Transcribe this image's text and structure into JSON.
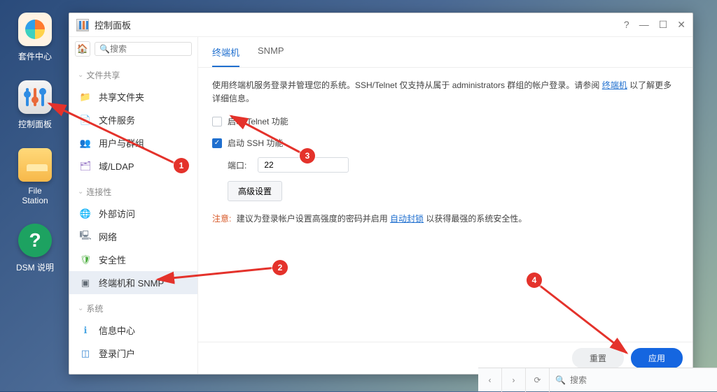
{
  "desktop": {
    "icons": [
      {
        "label": "套件中心",
        "name": "pkg-center"
      },
      {
        "label": "控制面板",
        "name": "control-panel"
      },
      {
        "label": "File Station",
        "name": "file-station"
      },
      {
        "label": "DSM 说明",
        "name": "dsm-help"
      }
    ]
  },
  "window": {
    "title": "控制面板",
    "search_placeholder": "搜索"
  },
  "sidebar": {
    "sections": {
      "fs": "文件共享",
      "conn": "连接性",
      "sys": "系统"
    },
    "items": {
      "shared_folder": "共享文件夹",
      "file_services": "文件服务",
      "user_group": "用户与群组",
      "domain_ldap": "域/LDAP",
      "ext_access": "外部访问",
      "network": "网络",
      "security": "安全性",
      "terminal_snmp": "终端机和 SNMP",
      "info_center": "信息中心",
      "login_portal": "登录门户"
    }
  },
  "tabs": {
    "terminal": "终端机",
    "snmp": "SNMP"
  },
  "content": {
    "desc_pre": "使用终端机服务登录并管理您的系统。SSH/Telnet 仅支持从属于 administrators 群组的帐户登录。请参阅",
    "desc_link": "终端机",
    "desc_post": "以了解更多详细信息。",
    "telnet_cb": "启动 Telnet 功能",
    "ssh_cb": "启动 SSH 功能",
    "port_label": "端口:",
    "port_value": "22",
    "adv_btn": "高级设置",
    "note_warn": "注意:",
    "note_pre": "建议为登录帐户设置高强度的密码并启用",
    "note_link": "自动封锁",
    "note_post": "以获得最强的系统安全性。"
  },
  "footer": {
    "reset": "重置",
    "apply": "应用"
  },
  "bottombar": {
    "search_placeholder": "搜索"
  },
  "markers": {
    "1": "1",
    "2": "2",
    "3": "3",
    "4": "4"
  }
}
